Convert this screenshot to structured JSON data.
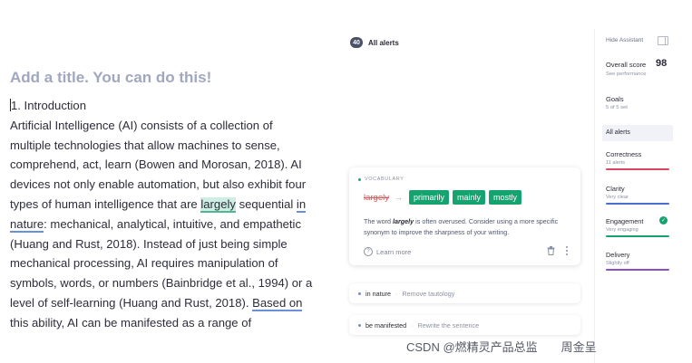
{
  "editor": {
    "title": "Add a title. You can do this!",
    "lines": [
      "1. Introduction",
      "Artificial Intelligence (AI) consists of a collection of",
      "multiple technologies that allow machines to sense,",
      "comprehend, act, learn (Bowen and Morosan, 2018). AI",
      "devices not only enable automation, but also exhibit four",
      {
        "a": "types of human intelligence that are ",
        "b": "largely",
        "c": " sequential ",
        "d": "in"
      },
      {
        "a": "nature",
        "b": ": mechanical, analytical, intuitive, and empathetic"
      },
      "(Huang and Rust, 2018). Instead of just being simple",
      "mechanical processing, AI requires manipulation of",
      "symbols, words, or numbers (Bainbridge et al., 1994) or a",
      {
        "a": "level of self-learning (Huang and Rust, 2018). ",
        "b": "Based on"
      },
      "this ability, AI can be manifested as a range of"
    ]
  },
  "alerts_panel": {
    "count": "40",
    "title": "All alerts",
    "card": {
      "category": "VOCABULARY",
      "original_word": "largely",
      "suggestions": [
        "primarily",
        "mainly",
        "mostly"
      ],
      "desc_before": "The word ",
      "desc_word": "largely",
      "desc_after": " is often overused. Consider using a more specific synonym to improve the sharpness of your writing.",
      "learn_more": "Learn more"
    },
    "mini_cards": [
      {
        "phrase": "in nature",
        "action": "Remove tautology"
      },
      {
        "phrase": "be manifested",
        "action": "Rewrite the sentence"
      }
    ]
  },
  "sidebar": {
    "hide_assistant": "Hide Assistant",
    "overall_score_label": "Overall score",
    "overall_score": "98",
    "score_sub": "See performance",
    "goals_label": "Goals",
    "goals_sub": "5 of 5 set",
    "all_alerts": "All alerts",
    "categories": [
      {
        "name": "Correctness",
        "sub": "11 alerts",
        "color": "#d9465f"
      },
      {
        "name": "Clarity",
        "sub": "Very clear",
        "color": "#4a6fd1"
      },
      {
        "name": "Engagement",
        "sub": "Very engaging",
        "color": "#15a370"
      },
      {
        "name": "Delivery",
        "sub": "Slightly off",
        "color": "#8a4fc4"
      }
    ]
  },
  "watermark": "CSDN @燃精灵产品总监　　周金呈"
}
